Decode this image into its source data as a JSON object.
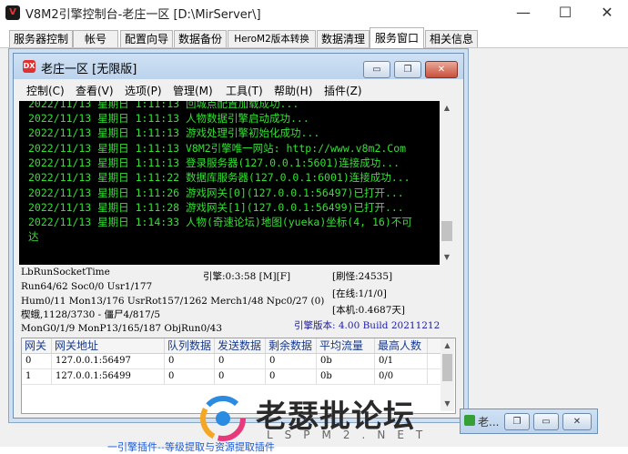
{
  "app": {
    "title": "V8M2引擎控制台-老庄一区 [D:\\MirServer\\]",
    "icon_text": "V"
  },
  "window_controls": {
    "minimize": "—",
    "maximize": "☐",
    "close": "✕"
  },
  "tabs": [
    {
      "label": "服务器控制"
    },
    {
      "label": "帐号"
    },
    {
      "label": "配置向导"
    },
    {
      "label": "数据备份"
    },
    {
      "label": "HeroM2版本转换"
    },
    {
      "label": "数据清理"
    },
    {
      "label": "服务窗口",
      "active": true
    },
    {
      "label": "相关信息"
    }
  ],
  "inner": {
    "title": "老庄一区 [无限版]",
    "icon_text": "DX",
    "menu": [
      {
        "label": "控制(C)"
      },
      {
        "label": "查看(V)"
      },
      {
        "label": "选项(P)"
      },
      {
        "label": "管理(M)"
      },
      {
        "label": "工具(T)"
      },
      {
        "label": "帮助(H)"
      },
      {
        "label": "插件(Z)"
      }
    ],
    "log": [
      "2022/11/13 星期日 1:11:13 回城点配置加载成功...",
      "2022/11/13 星期日 1:11:13 人物数据引擎启动成功...",
      "2022/11/13 星期日 1:11:13 游戏处理引擎初始化成功...",
      "2022/11/13 星期日 1:11:13 V8M2引擎唯一网站: http://www.v8m2.Com",
      "2022/11/13 星期日 1:11:13 登录服务器(127.0.0.1:5601)连接成功...",
      "2022/11/13 星期日 1:11:22 数据库服务器(127.0.0.1:6001)连接成功...",
      "2022/11/13 星期日 1:11:26 游戏网关[0](127.0.0.1:56497)已打开...",
      "2022/11/13 星期日 1:11:28 游戏网关[1](127.0.0.1:56499)已打开...",
      "2022/11/13 星期日 1:14:33 人物(奇速论坛)地图(yueka)坐标(4, 16)不可",
      "达"
    ],
    "status": {
      "socket_time": "LbRunSocketTime",
      "engine": "引擎:0:3:58 [M][F]",
      "refresh": "[刷怪:24535]",
      "run": "Run64/62 Soc0/0 Usr1/177",
      "online": "[在线:1/1/0]",
      "hum": "Hum0/11 Mon13/176 UsrRot157/1262 Merch1/48 Npc0/27 (0)",
      "local": "[本机:0.4687天]",
      "memory": "楔蛾,1128/3730 - 僵尸4/817/5",
      "mongo": "MonG0/1/9 MonP13/165/187 ObjRun0/43",
      "version": "引擎版本: 4.00 Build 20211212"
    },
    "grid": {
      "columns": [
        "网关",
        "网关地址",
        "队列数据",
        "发送数据",
        "剩余数据",
        "平均流量",
        "最高人数"
      ],
      "rows": [
        [
          "0",
          "127.0.0.1:56497",
          "0",
          "0",
          "0",
          "0b",
          "0/1"
        ],
        [
          "1",
          "127.0.0.1:56499",
          "0",
          "0",
          "0",
          "0b",
          "0/0"
        ]
      ]
    },
    "buttons": {
      "minimize": "▭",
      "restore": "❐",
      "close": "✕"
    }
  },
  "minibar": {
    "title": "老...",
    "restore": "❐",
    "maximize": "▭",
    "close": "✕"
  },
  "watermark": {
    "text": "老瑟批论坛",
    "sub": "LSPM2.NET"
  },
  "bottom_link": {
    "text": "一引擎插件--等级提取与资源提取插件"
  },
  "colors": {
    "console_bg": "#000000",
    "console_text": "#34e034",
    "header_text": "#1a3a8a",
    "version_text": "#1a1aa8"
  }
}
